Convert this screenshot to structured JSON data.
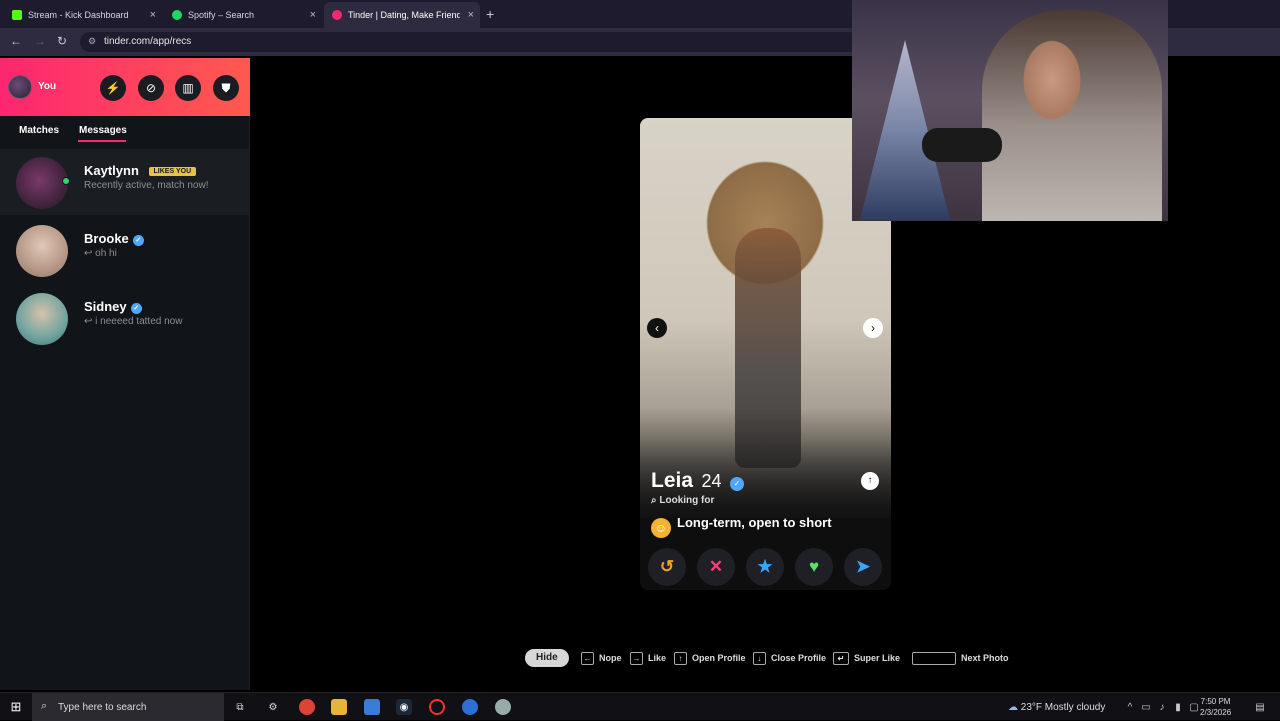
{
  "browser": {
    "tabs": [
      {
        "title": "Stream - Kick Dashboard",
        "favicon_color": "#53fc18"
      },
      {
        "title": "Spotify – Search",
        "favicon_color": "#1ed760"
      },
      {
        "title": "Tinder | Dating, Make Friends &",
        "favicon_color": "#fd2670"
      }
    ],
    "new_tab": "+",
    "url": "tinder.com/app/recs"
  },
  "sidebar": {
    "you_label": "You",
    "header_buttons": [
      "boost-icon",
      "explore-icon",
      "gift-icon",
      "shield-icon"
    ],
    "tabs": {
      "matches": "Matches",
      "messages": "Messages"
    },
    "conversations": [
      {
        "name": "Kaytlynn",
        "badge": "LIKES YOU",
        "message": "Recently active, match now!"
      },
      {
        "name": "Brooke",
        "message": "↩ oh hi"
      },
      {
        "name": "Sidney",
        "message": "↩ i neeeed tatted now"
      }
    ]
  },
  "card": {
    "name": "Leia",
    "age": "24",
    "looking_label": "Looking for",
    "intent": "Long-term, open to short",
    "actions": [
      "rewind-icon",
      "nope-icon",
      "super-like-icon",
      "like-icon",
      "boost-icon"
    ]
  },
  "shortcuts": {
    "hide": "Hide",
    "nope": "Nope",
    "like": "Like",
    "open_profile": "Open Profile",
    "close_profile": "Close Profile",
    "super_like": "Super Like",
    "next_photo": "Next Photo"
  },
  "taskbar": {
    "search_placeholder": "Type here to search",
    "weather": "23°F  Mostly cloudy",
    "time": "7:50 PM",
    "date": "2/3/2026"
  }
}
